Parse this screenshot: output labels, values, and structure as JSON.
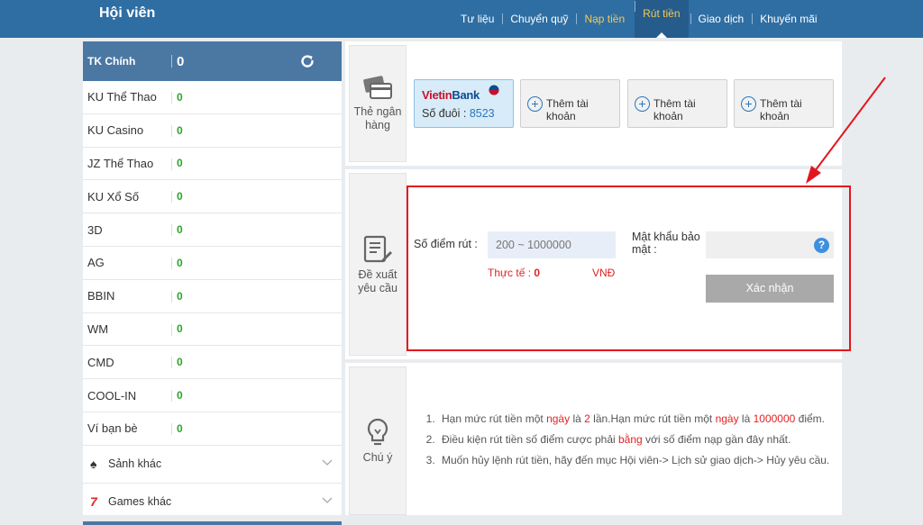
{
  "header": {
    "title": "Hội viên",
    "nav": [
      {
        "label": "Tư liệu"
      },
      {
        "label": "Chuyển quỹ"
      },
      {
        "label": "Nạp tiền"
      },
      {
        "label": "Rút tiền"
      },
      {
        "label": "Giao dịch"
      },
      {
        "label": "Khuyến mãi"
      }
    ]
  },
  "sidebar": {
    "main": {
      "label": "TK Chính",
      "value": "0"
    },
    "accounts": [
      {
        "label": "KU Thể Thao",
        "value": "0"
      },
      {
        "label": "KU Casino",
        "value": "0"
      },
      {
        "label": "JZ Thể Thao",
        "value": "0"
      },
      {
        "label": "KU Xổ Số",
        "value": "0"
      },
      {
        "label": "3D",
        "value": "0"
      },
      {
        "label": "AG",
        "value": "0"
      },
      {
        "label": "BBIN",
        "value": "0"
      },
      {
        "label": "WM",
        "value": "0"
      },
      {
        "label": "CMD",
        "value": "0"
      },
      {
        "label": "COOL-IN",
        "value": "0"
      },
      {
        "label": "Ví bạn bè",
        "value": "0"
      }
    ],
    "groups": [
      {
        "label": "Sảnh khác",
        "icon": "spade-icon"
      },
      {
        "label": "Games khác",
        "icon": "seven-icon"
      }
    ]
  },
  "bank": {
    "section_label": "Thẻ ngân hàng",
    "card": {
      "bank_name_red": "Vietin",
      "bank_name_blue": "Bank",
      "suffix_label": "Số đuôi :",
      "suffix_value": "8523"
    },
    "add_label": "Thêm tài khoản"
  },
  "request": {
    "section_label": "Đề xuất yêu cầu",
    "amount_label": "Số điểm rút :",
    "amount_placeholder": "200 ~ 1000000",
    "actual_label": "Thực tế :",
    "actual_value": "0",
    "currency": "VNĐ",
    "password_label": "Mật khẩu bảo mật :",
    "help": "?",
    "confirm_label": "Xác nhận"
  },
  "notes": {
    "section_label": "Chú ý",
    "items": [
      {
        "p1": "Hạn mức rút tiền một ",
        "r1": "ngày",
        "p2": " là ",
        "r2": "2",
        "p3": " lần.Hạn mức rút tiền một ",
        "r3": "ngày",
        "p4": " là ",
        "r4": "1000000",
        "p5": " điểm."
      },
      {
        "p1": "Điều kiện rút tiền số điểm cược phải ",
        "r1": "bằng",
        "p2": " với số điểm nạp gần đây nhất."
      },
      {
        "p1": "Muốn hủy lệnh rút tiền, hãy đến mục Hội viên-> Lịch sử giao dịch-> Hủy yêu cầu."
      }
    ]
  },
  "colors": {
    "header": "#2f6ea3",
    "accent_gold": "#f7c948",
    "annotation": "#e3161d",
    "value_green": "#2aa52a"
  }
}
